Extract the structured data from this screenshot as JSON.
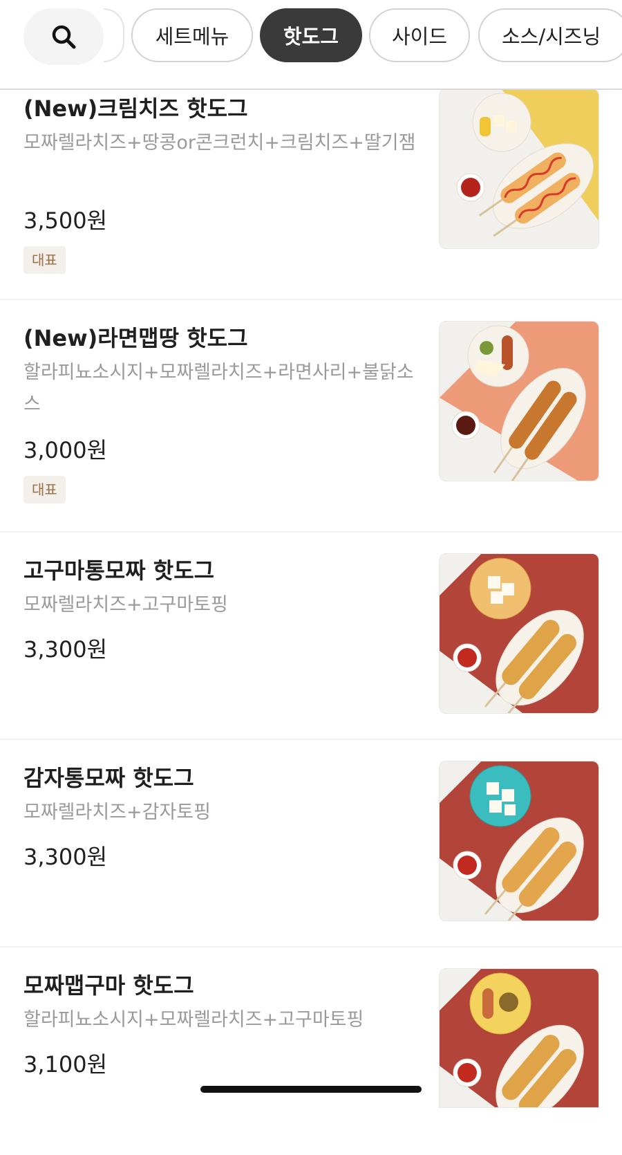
{
  "categories": {
    "search_icon": "search-icon",
    "chips": [
      {
        "label": "세트메뉴",
        "active": false
      },
      {
        "label": "핫도그",
        "active": true
      },
      {
        "label": "사이드",
        "active": false
      },
      {
        "label": "소스/시즈닝",
        "active": false
      }
    ]
  },
  "items": [
    {
      "name": "(New)크림치즈 핫도그",
      "desc": "모짜렐라치즈+땅콩or콘크런치+크림치즈+딸기잼",
      "price": "3,500원",
      "badge": "대표",
      "image": {
        "bg": "#f2f0ec",
        "accent": "#efce5c",
        "plate": "#f6f2ea",
        "food": "#f0b060",
        "sauce": "#b4231c",
        "side": "cheese-and-corn"
      }
    },
    {
      "name": "(New)라면맵땅 핫도그",
      "desc": "할라피뇨소시지+모짜렐라치즈+라면사리+불닭소스",
      "price": "3,000원",
      "badge": "대표",
      "image": {
        "bg": "#f2f0ec",
        "accent": "#ec9a77",
        "plate": "#f6f2ea",
        "food": "#c7782e",
        "sauce": "#5a1a12",
        "side": "sausage-and-cheese"
      }
    },
    {
      "name": "고구마통모짜 핫도그",
      "desc": "모짜렐라치즈+고구마토핑",
      "price": "3,300원",
      "badge": "",
      "image": {
        "bg": "#f2f0ec",
        "accent": "#b3443a",
        "plate": "#f6f2ea",
        "food": "#e0a448",
        "sauce": "#c22a1f",
        "side": "cheese-cubes"
      }
    },
    {
      "name": "감자통모짜 핫도그",
      "desc": "모짜렐라치즈+감자토핑",
      "price": "3,300원",
      "badge": "",
      "image": {
        "bg": "#f2f0ec",
        "accent": "#b3443a",
        "plate": "#3bbdbf",
        "food": "#e3a64d",
        "sauce": "#c22a1f",
        "side": "cheese-cubes"
      }
    },
    {
      "name": "모짜맵구마 핫도그",
      "desc": "할라피뇨소시지+모짜렐라치즈+고구마토핑",
      "price": "3,100원",
      "badge": "",
      "image": {
        "bg": "#f2f0ec",
        "accent": "#b3443a",
        "plate": "#f3d25e",
        "food": "#e0a448",
        "sauce": "#c22a1f",
        "side": "sausage-and-jalapeno"
      }
    }
  ]
}
